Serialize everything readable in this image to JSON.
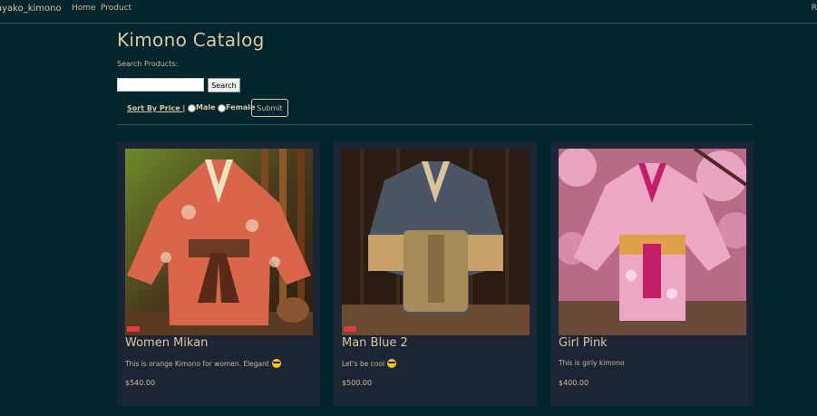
{
  "nav": {
    "brand": "ayako_kimono",
    "links": [
      "Home",
      "Product"
    ],
    "right_text": "R"
  },
  "catalog": {
    "title": "Kimono Catalog",
    "search_label": "Search Products:",
    "search_value": "",
    "search_button": "Search",
    "sort_link": "Sort By Price |",
    "filter_options": [
      "Male",
      "Female"
    ],
    "submit_button": "Submit"
  },
  "products": [
    {
      "name": "Women Mikan",
      "description": "This is orange Kimono for women. Elegant",
      "has_emoji": true,
      "price": "$540.00",
      "icon": "orange-kimono-photo"
    },
    {
      "name": "Man Blue 2",
      "description": "Let's be cool",
      "has_emoji": true,
      "price": "$500.00",
      "icon": "blue-kimono-photo"
    },
    {
      "name": "Girl Pink",
      "description": "This is girly kimono",
      "has_emoji": false,
      "price": "$400.00",
      "icon": "pink-kimono-photo"
    }
  ],
  "colors": {
    "background": "#03252d",
    "card": "#1b2535",
    "accent": "#d9c7a1"
  }
}
